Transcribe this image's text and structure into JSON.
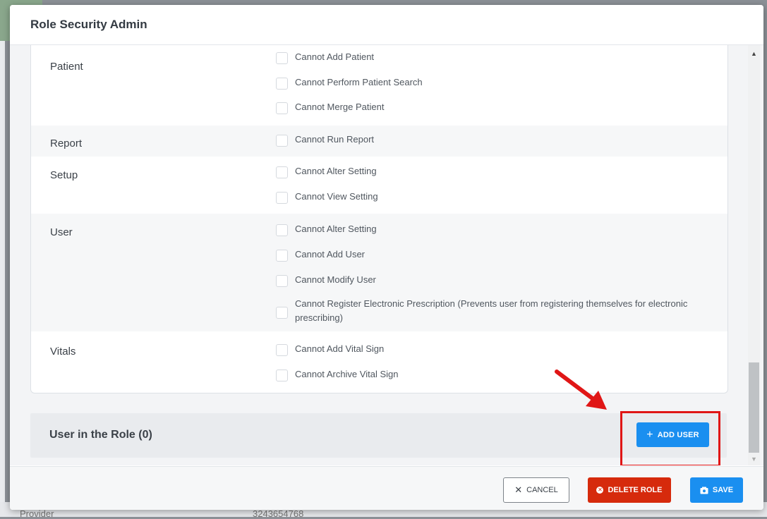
{
  "modal": {
    "title": "Role Security Admin"
  },
  "permissions": [
    {
      "group": "Patient",
      "items": [
        "Cannot Add Patient",
        "Cannot Perform Patient Search",
        "Cannot Merge Patient"
      ]
    },
    {
      "group": "Report",
      "items": [
        "Cannot Run Report"
      ]
    },
    {
      "group": "Setup",
      "items": [
        "Cannot Alter Setting",
        "Cannot View Setting"
      ]
    },
    {
      "group": "User",
      "items": [
        "Cannot Alter Setting",
        "Cannot Add User",
        "Cannot Modify User",
        "Cannot Register Electronic Prescription (Prevents user from registering themselves for electronic prescribing)"
      ]
    },
    {
      "group": "Vitals",
      "items": [
        "Cannot Add Vital Sign",
        "Cannot Archive Vital Sign"
      ]
    }
  ],
  "role_users": {
    "title": "User in the Role (0)",
    "add_button": "ADD USER"
  },
  "footer": {
    "cancel": "CANCEL",
    "delete": "DELETE ROLE",
    "save": "SAVE"
  },
  "background": {
    "row_label": "Provider",
    "row_value": "3243654768"
  },
  "colors": {
    "primary": "#1a8ff0",
    "danger": "#d62a0c",
    "highlight": "#e01616"
  },
  "icons": {
    "cancel": "close-icon",
    "delete": "times-circle-icon",
    "save": "save-icon",
    "add": "plus-icon"
  }
}
